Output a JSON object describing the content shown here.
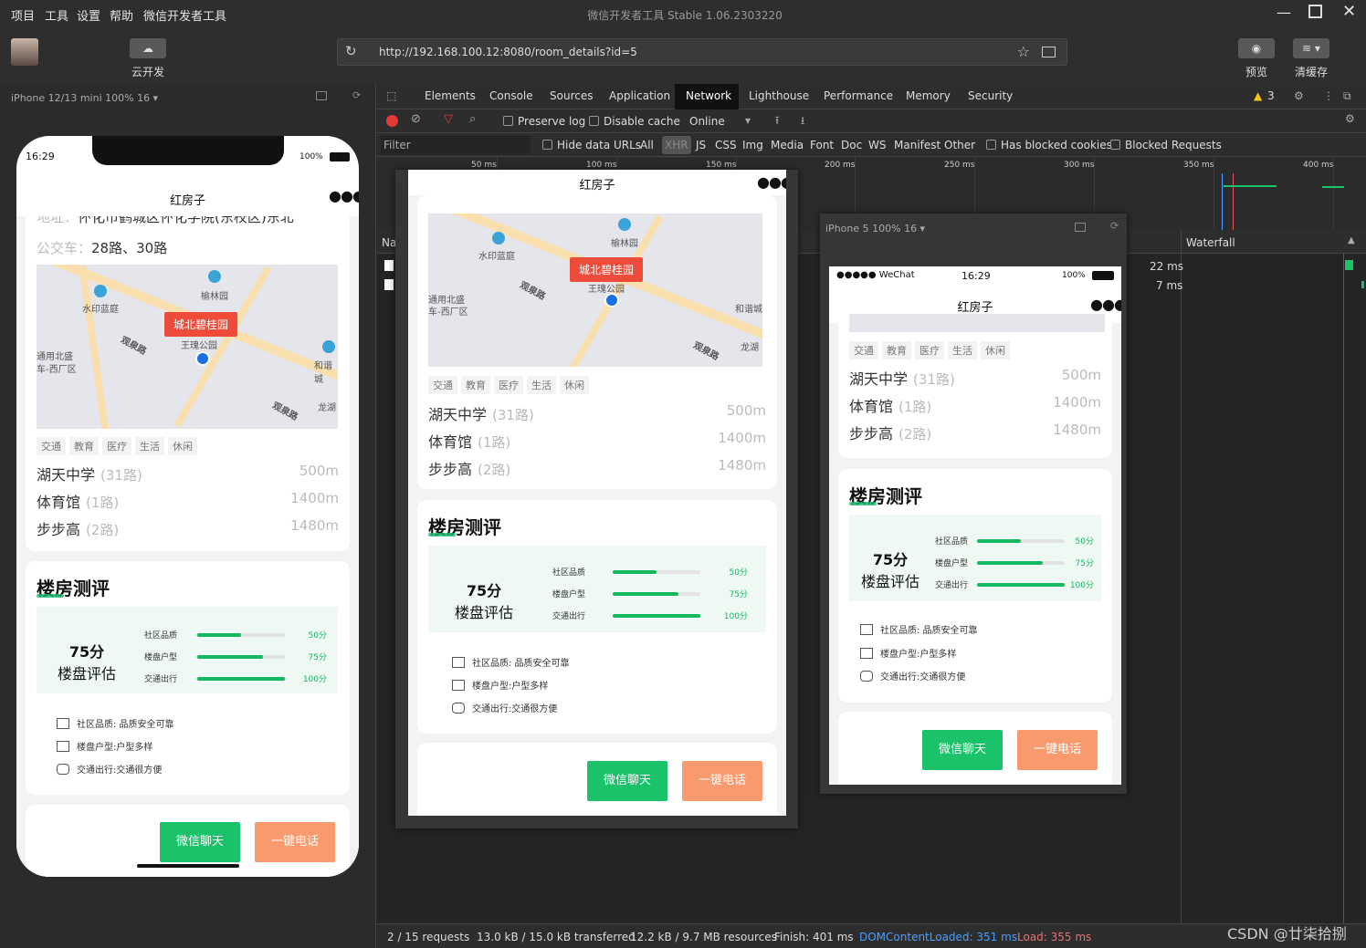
{
  "menu": [
    "项目",
    "工具",
    "设置",
    "帮助",
    "微信开发者工具"
  ],
  "window_title": "微信开发者工具 Stable 1.06.2303220",
  "toolbar": {
    "cloud_label": "云开发",
    "preview_label": "预览",
    "clear_cache_label": "清缓存"
  },
  "url": "http://192.168.100.12:8080/room_details?id=5",
  "simulator": {
    "device": "iPhone 12/13 mini 100% 16 ▾"
  },
  "devtools": {
    "tabs": [
      "Elements",
      "Console",
      "Sources",
      "Application",
      "Network",
      "Lighthouse",
      "Performance",
      "Memory",
      "Security"
    ],
    "active_tab": "Network",
    "warnings": "3",
    "preserve_log": "Preserve log",
    "disable_cache": "Disable cache",
    "throttle": "Online",
    "filter_placeholder": "Filter",
    "hide_data_urls": "Hide data URLs",
    "types": [
      "All",
      "XHR",
      "JS",
      "CSS",
      "Img",
      "Media",
      "Font",
      "Doc",
      "WS",
      "Manifest",
      "Other"
    ],
    "has_blocked_cookies": "Has blocked cookies",
    "blocked_requests": "Blocked Requests",
    "timeline_ticks": [
      "50 ms",
      "100 ms",
      "150 ms",
      "200 ms",
      "250 ms",
      "300 ms",
      "350 ms",
      "400 ms"
    ],
    "col_name": "Na",
    "waterfall": "Waterfall",
    "times": [
      "22 ms",
      "7 ms"
    ],
    "status": {
      "requests": "2 / 15 requests",
      "transferred": "13.0 kB / 15.0 kB transferred",
      "resources": "12.2 kB / 9.7 MB resources",
      "finish": "Finish: 401 ms",
      "dcl": "DOMContentLoaded: 351 ms",
      "load": "Load: 355 ms"
    }
  },
  "watermark": "CSDN @廿柒拾捌",
  "phone": {
    "time": "16:29",
    "battery": "100%",
    "nav_title": "红房子",
    "address_label": "地址：",
    "address": "怀化市鹤城区怀化学院(东校区)东北",
    "bus_label": "公交车：",
    "bus": "28路、30路",
    "map": {
      "badge": "城北碧桂园",
      "labels": [
        "水印蓝庭",
        "榆林园",
        "观泉路",
        "观泉路",
        "怀化学院",
        "和谐城",
        "龙湖",
        "王瑰公园",
        "通用北盛",
        "车-西厂区"
      ]
    },
    "tags": [
      "交通",
      "教育",
      "医疗",
      "生活",
      "休闲"
    ],
    "pois": [
      {
        "name": "湖天中学",
        "sub": "(31路)",
        "dist": "500m"
      },
      {
        "name": "体育馆",
        "sub": "(1路)",
        "dist": "1400m"
      },
      {
        "name": "步步高",
        "sub": "(2路)",
        "dist": "1480m"
      }
    ],
    "review_title": "楼房测评",
    "score": "75分",
    "score_label": "楼盘评估",
    "bars": [
      {
        "label": "社区品质",
        "value": "50分",
        "pct": 50
      },
      {
        "label": "楼盘户型",
        "value": "75分",
        "pct": 75
      },
      {
        "label": "交通出行",
        "value": "100分",
        "pct": 100
      }
    ],
    "features": [
      "社区品质: 品质安全可靠",
      "楼盘户型:户型多样",
      "交通出行:交通很方便"
    ],
    "btn_chat": "微信聊天",
    "btn_call": "一键电话"
  },
  "iphone5": {
    "device": "iPhone 5 100% 16 ▾",
    "carrier": "●●●●● WeChat",
    "time": "16:29",
    "battery": "100%"
  }
}
